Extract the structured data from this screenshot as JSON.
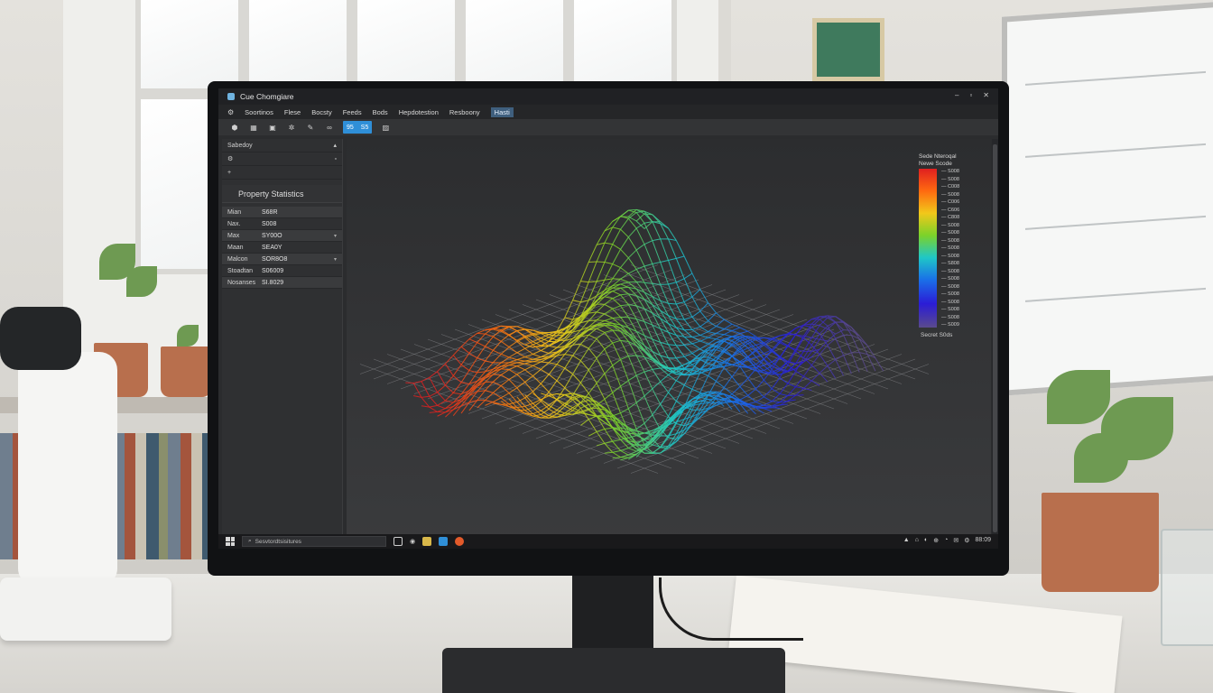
{
  "window": {
    "title": "Cue Chomgiare",
    "controls": {
      "minimize": "–",
      "maximize": "▫",
      "close": "✕"
    }
  },
  "menu": {
    "gear_icon": "gear-icon",
    "items": [
      "Soortinos",
      "Flese",
      "Bocsty",
      "Feeds",
      "Bods",
      "Hepdotestion",
      "Resboony",
      "Hasti"
    ],
    "active_index": 7
  },
  "toolbar": {
    "group_labels": [
      "95",
      "S5"
    ]
  },
  "sidebar": {
    "header_label": "Sabedoy",
    "rows": [
      {
        "left": "⚙",
        "right": "▫"
      },
      {
        "left": "+",
        "right": ""
      }
    ],
    "panel_title": "Property Statistics",
    "stats": [
      {
        "label": "Mian",
        "value": "S68R",
        "arrow": ""
      },
      {
        "label": "Nax.",
        "value": "S008",
        "arrow": ""
      },
      {
        "label": "Max",
        "value": "SY00O",
        "arrow": "▾"
      },
      {
        "label": "Maan",
        "value": "SEA0Y",
        "arrow": ""
      },
      {
        "label": "Malcon",
        "value": "SOR8O8",
        "arrow": "▾"
      },
      {
        "label": "Stoadtan",
        "value": "S06009",
        "arrow": ""
      },
      {
        "label": "Nosanses",
        "value": "SI.8029",
        "arrow": ""
      }
    ]
  },
  "legend": {
    "title_lines": [
      "Sede Nteroqal",
      "Newe          Scode"
    ],
    "ticks": [
      "S008",
      "S008",
      "C008",
      "S008",
      "C006",
      "C606",
      "C808",
      "S008",
      "S008",
      "S008",
      "S008",
      "S008",
      "S808",
      "S008",
      "S008",
      "S008",
      "S008",
      "S008",
      "S008",
      "S008",
      "S009"
    ],
    "footer": "Secret S0ds",
    "colors": [
      "#e02020",
      "#ff6a10",
      "#f2c81a",
      "#7bd22a",
      "#1fc7c7",
      "#1a6fe8",
      "#2b1cd6",
      "#5a4a8c"
    ]
  },
  "taskbar": {
    "search_placeholder": "Sesvtordtsisitures",
    "tray": [
      "▲",
      "⌂",
      "◐",
      "⊕",
      "◔",
      "✉",
      "⚙",
      "⊞"
    ],
    "clock": "88:09"
  },
  "accent_color": "#2f8fd8"
}
